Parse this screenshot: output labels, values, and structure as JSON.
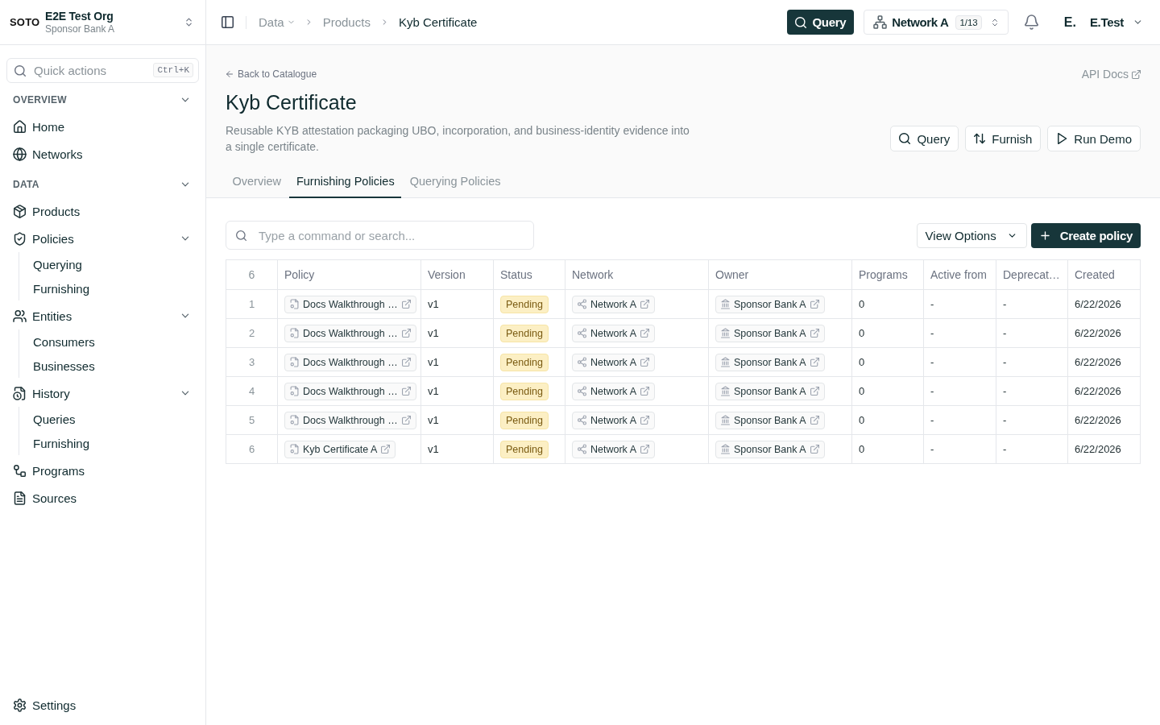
{
  "sidebar": {
    "logo": "SOTO",
    "org_name": "E2E Test Org",
    "org_subtitle": "Sponsor Bank A",
    "quick_actions": {
      "placeholder": "Quick actions",
      "shortcut": "Ctrl+K"
    },
    "sections": [
      {
        "title": "OVERVIEW",
        "expanded": true,
        "items": [
          {
            "label": "Home"
          },
          {
            "label": "Networks"
          }
        ]
      },
      {
        "title": "DATA",
        "expanded": true,
        "items": [
          {
            "label": "Products"
          },
          {
            "label": "Policies",
            "expanded": true,
            "children": [
              {
                "label": "Querying"
              },
              {
                "label": "Furnishing"
              }
            ]
          },
          {
            "label": "Entities",
            "expanded": true,
            "children": [
              {
                "label": "Consumers"
              },
              {
                "label": "Businesses"
              }
            ]
          },
          {
            "label": "History",
            "expanded": true,
            "children": [
              {
                "label": "Queries"
              },
              {
                "label": "Furnishing"
              }
            ]
          },
          {
            "label": "Programs"
          },
          {
            "label": "Sources"
          }
        ]
      }
    ],
    "footer_item": {
      "label": "Settings"
    }
  },
  "topbar": {
    "breadcrumbs": [
      {
        "label": "Data",
        "kind": "menu"
      },
      {
        "label": "Products",
        "kind": "link"
      },
      {
        "label": "Kyb Certificate",
        "kind": "current"
      }
    ],
    "query_button": "Query",
    "network": {
      "label": "Network A",
      "count": "1/13"
    },
    "user": {
      "initials": "E.",
      "name": "E.Test"
    }
  },
  "page": {
    "back_link": "Back to Catalogue",
    "api_docs": "API Docs",
    "title": "Kyb Certificate",
    "description": "Reusable KYB attestation packaging UBO, incorporation, and business-identity evidence into a single certificate.",
    "actions": [
      "Query",
      "Furnish",
      "Run Demo"
    ],
    "tabs": [
      {
        "label": "Overview",
        "selected": false
      },
      {
        "label": "Furnishing Policies",
        "selected": true
      },
      {
        "label": "Querying Policies",
        "selected": false
      }
    ]
  },
  "toolbar": {
    "search": {
      "placeholder": "Type a command or search..."
    },
    "view_options": "View Options",
    "create_button": "Create policy"
  },
  "table": {
    "row_count": "6",
    "columns": [
      "Policy",
      "Version",
      "Status",
      "Network",
      "Owner",
      "Programs",
      "Active from",
      "Deprecat…",
      "Created"
    ],
    "rows": [
      {
        "number": "1",
        "policy": "Docs Walkthrough …",
        "version": "v1",
        "status": "Pending",
        "network": "Network A",
        "owner": "Sponsor Bank A",
        "programs": "0",
        "active_from": "-",
        "column_9": "-",
        "created": "6/22/2026"
      },
      {
        "number": "2",
        "policy": "Docs Walkthrough …",
        "version": "v1",
        "status": "Pending",
        "network": "Network A",
        "owner": "Sponsor Bank A",
        "programs": "0",
        "active_from": "-",
        "column_9": "-",
        "created": "6/22/2026"
      },
      {
        "number": "3",
        "policy": "Docs Walkthrough …",
        "version": "v1",
        "status": "Pending",
        "network": "Network A",
        "owner": "Sponsor Bank A",
        "programs": "0",
        "active_from": "-",
        "column_9": "-",
        "created": "6/22/2026"
      },
      {
        "number": "4",
        "policy": "Docs Walkthrough …",
        "version": "v1",
        "status": "Pending",
        "network": "Network A",
        "owner": "Sponsor Bank A",
        "programs": "0",
        "active_from": "-",
        "column_9": "-",
        "created": "6/22/2026"
      },
      {
        "number": "5",
        "policy": "Docs Walkthrough …",
        "version": "v1",
        "status": "Pending",
        "network": "Network A",
        "owner": "Sponsor Bank A",
        "programs": "0",
        "active_from": "-",
        "column_9": "-",
        "created": "6/22/2026"
      },
      {
        "number": "6",
        "policy": "Kyb Certificate A",
        "version": "v1",
        "status": "Pending",
        "network": "Network A",
        "owner": "Sponsor Bank A",
        "programs": "0",
        "active_from": "-",
        "column_9": "-",
        "created": "6/22/2026"
      }
    ]
  }
}
